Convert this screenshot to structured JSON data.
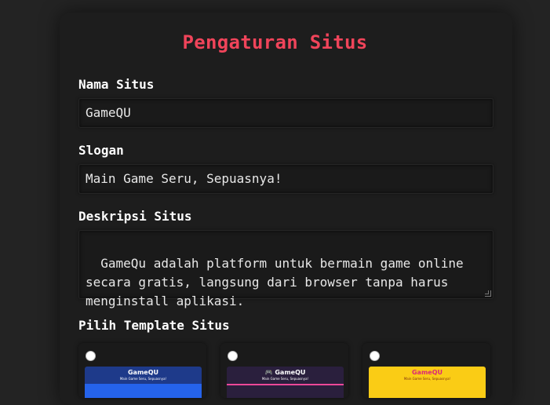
{
  "title": "Pengaturan Situs",
  "fields": {
    "site_name": {
      "label": "Nama Situs",
      "value": "GameQU"
    },
    "slogan": {
      "label": "Slogan",
      "value": "Main Game Seru, Sepuasnya!"
    },
    "description": {
      "label": "Deskripsi Situs",
      "value": "GameQu adalah platform untuk bermain game online\nsecara gratis, langsung dari browser tanpa harus\nmenginstall aplikasi."
    }
  },
  "template_section": {
    "label": "Pilih Template Situs",
    "templates": [
      {
        "title": "GameQU",
        "subtitle": "Main Game Seru, Sepuasnya!"
      },
      {
        "title": "🎮 GameQU",
        "subtitle": "Main Game Seru, Sepuasnya!"
      },
      {
        "title": "GameQU",
        "subtitle": "Main Game Seru, Sepuasnya!"
      }
    ]
  },
  "colors": {
    "accent": "#f0445a",
    "background": "#232323",
    "card": "#1d1d1d"
  }
}
